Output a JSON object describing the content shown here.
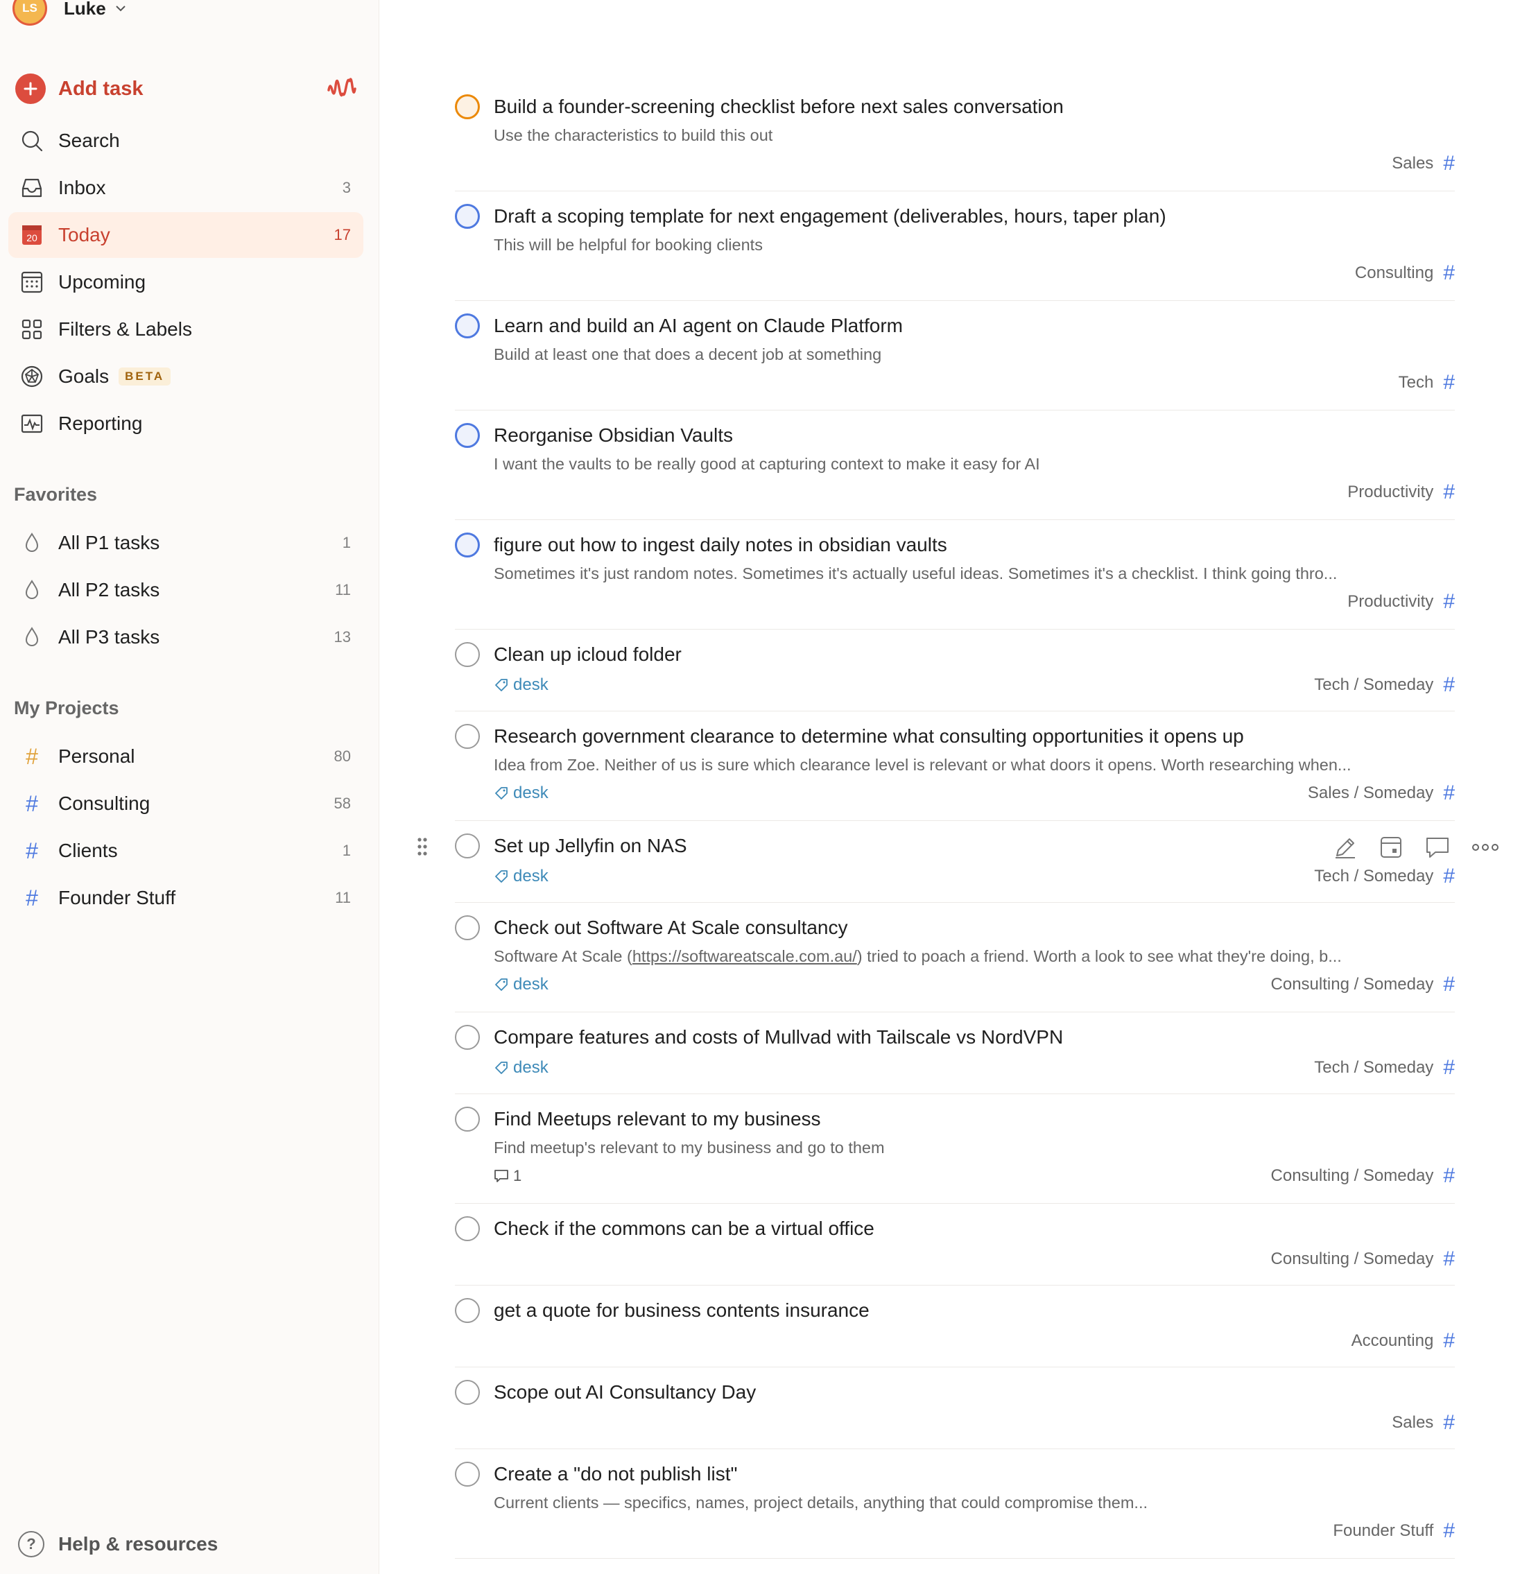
{
  "user": {
    "initials": "LS",
    "name": "Luke"
  },
  "sidebar": {
    "add_task_label": "Add task",
    "nav": [
      {
        "label": "Search",
        "count": ""
      },
      {
        "label": "Inbox",
        "count": "3"
      },
      {
        "label": "Today",
        "count": "17",
        "day": "20"
      },
      {
        "label": "Upcoming",
        "count": ""
      },
      {
        "label": "Filters & Labels",
        "count": ""
      },
      {
        "label": "Goals",
        "count": "",
        "badge": "BETA"
      },
      {
        "label": "Reporting",
        "count": ""
      }
    ],
    "favorites_title": "Favorites",
    "favorites": [
      {
        "label": "All P1 tasks",
        "count": "1"
      },
      {
        "label": "All P2 tasks",
        "count": "11"
      },
      {
        "label": "All P3 tasks",
        "count": "13"
      }
    ],
    "projects_title": "My Projects",
    "projects": [
      {
        "label": "Personal",
        "count": "80",
        "color": "#e0a23b"
      },
      {
        "label": "Consulting",
        "count": "58",
        "color": "#4f7ae0"
      },
      {
        "label": "Clients",
        "count": "1",
        "color": "#4f7ae0"
      },
      {
        "label": "Founder Stuff",
        "count": "11",
        "color": "#4f7ae0"
      }
    ],
    "help_label": "Help & resources"
  },
  "colors": {
    "accent": "#dc4c3e",
    "p2": "#4e79e0",
    "p3": "#eb8909",
    "label": "#3e8ab8"
  },
  "tasks": [
    {
      "title": "Build a founder-screening checklist before next sales conversation",
      "desc": "Use the characteristics to build this out",
      "project": "Sales",
      "priority": "p3"
    },
    {
      "title": "Draft a scoping template for next engagement (deliverables, hours, taper plan)",
      "desc": "This will be helpful for booking clients",
      "project": "Consulting",
      "priority": "p2"
    },
    {
      "title": "Learn and build an AI agent on Claude Platform",
      "desc": "Build at least one that does a decent job at something",
      "project": "Tech",
      "priority": "p2"
    },
    {
      "title": "Reorganise Obsidian Vaults",
      "desc": "I want the vaults to be really good at capturing context to make it easy for AI",
      "project": "Productivity",
      "priority": "p2"
    },
    {
      "title": "figure out how to ingest daily notes in obsidian vaults",
      "desc": "Sometimes it's just random notes. Sometimes it's actually useful ideas. Sometimes it's a checklist. I think going thro...",
      "project": "Productivity",
      "priority": "p2"
    },
    {
      "title": "Clean up icloud folder",
      "label": "desk",
      "project": "Tech / Someday",
      "priority": "p4"
    },
    {
      "title": "Research government clearance to determine what consulting opportunities it opens up",
      "desc": "Idea from Zoe. Neither of us is sure which clearance level is relevant or what doors it opens. Worth researching when...",
      "label": "desk",
      "project": "Sales / Someday",
      "priority": "p4"
    },
    {
      "title": "Set up Jellyfin on NAS",
      "label": "desk",
      "project": "Tech / Someday",
      "priority": "p4"
    },
    {
      "title": "Check out Software At Scale consultancy",
      "desc_pre": "Software At Scale (",
      "desc_link": "https://softwareatscale.com.au/",
      "desc_post": ") tried to poach a friend. Worth a look to see what they're doing, b...",
      "label": "desk",
      "project": "Consulting / Someday",
      "priority": "p4"
    },
    {
      "title": "Compare features and costs of Mullvad with Tailscale vs NordVPN",
      "label": "desk",
      "project": "Tech / Someday",
      "priority": "p4"
    },
    {
      "title": "Find Meetups relevant to my business",
      "desc": "Find meetup's relevant to my business and go to them",
      "comments": "1",
      "project": "Consulting / Someday",
      "priority": "p4"
    },
    {
      "title": "Check if the commons can be a virtual office",
      "project": "Consulting / Someday",
      "priority": "p4"
    },
    {
      "title": "get a quote for business contents insurance",
      "project": "Accounting",
      "priority": "p4"
    },
    {
      "title": "Scope out AI Consultancy Day",
      "project": "Sales",
      "priority": "p4"
    },
    {
      "title": "Create a \"do not publish list\"",
      "desc": "Current clients — specifics, names, project details, anything that could compromise them...",
      "project": "Founder Stuff",
      "priority": "p4"
    }
  ]
}
